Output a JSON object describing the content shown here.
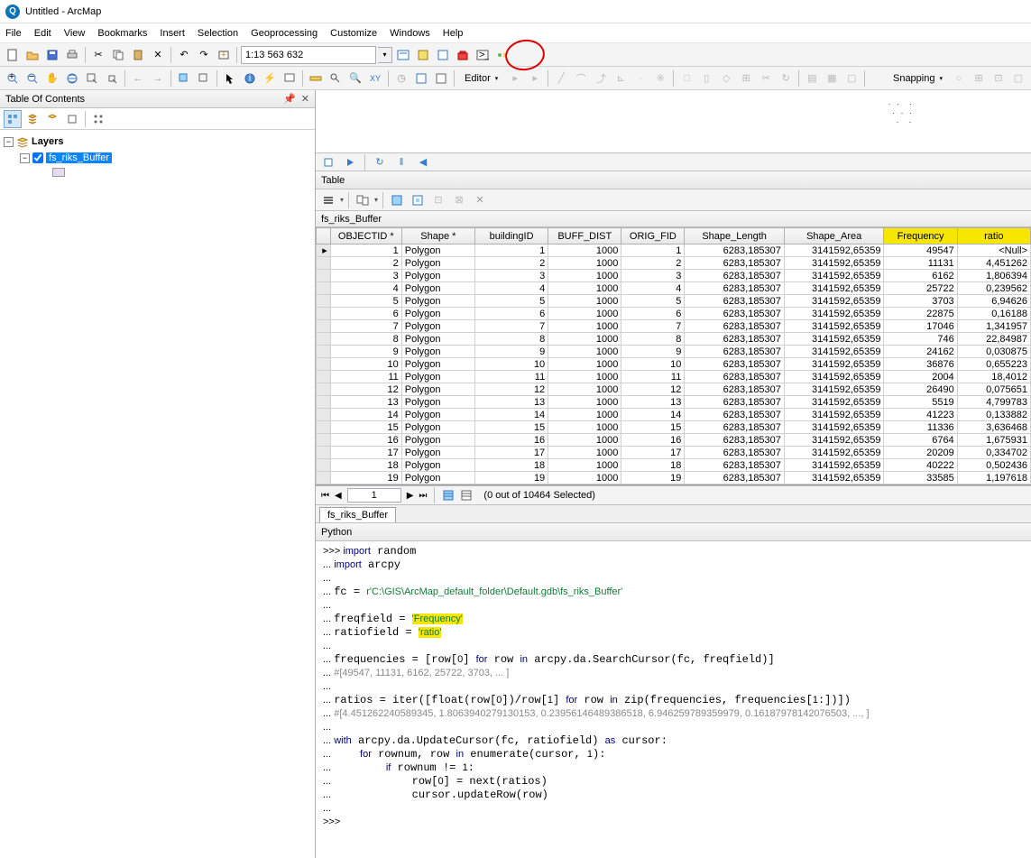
{
  "window": {
    "title": "Untitled - ArcMap"
  },
  "menu": [
    "File",
    "Edit",
    "View",
    "Bookmarks",
    "Insert",
    "Selection",
    "Geoprocessing",
    "Customize",
    "Windows",
    "Help"
  ],
  "scale": "1:13 563 632",
  "editor_label": "Editor",
  "snapping_label": "Snapping",
  "toc": {
    "title": "Table Of Contents",
    "root": "Layers",
    "layer": "fs_riks_Buffer"
  },
  "table": {
    "title": "Table",
    "name": "fs_riks_Buffer",
    "columns": [
      "OBJECTID *",
      "Shape *",
      "buildingID",
      "BUFF_DIST",
      "ORIG_FID",
      "Shape_Length",
      "Shape_Area",
      "Frequency",
      "ratio"
    ],
    "highlight_cols": [
      7,
      8
    ],
    "rows": [
      [
        1,
        "Polygon",
        1,
        1000,
        1,
        "6283,185307",
        "3141592,65359",
        49547,
        "<Null>"
      ],
      [
        2,
        "Polygon",
        2,
        1000,
        2,
        "6283,185307",
        "3141592,65359",
        11131,
        "4,451262"
      ],
      [
        3,
        "Polygon",
        3,
        1000,
        3,
        "6283,185307",
        "3141592,65359",
        6162,
        "1,806394"
      ],
      [
        4,
        "Polygon",
        4,
        1000,
        4,
        "6283,185307",
        "3141592,65359",
        25722,
        "0,239562"
      ],
      [
        5,
        "Polygon",
        5,
        1000,
        5,
        "6283,185307",
        "3141592,65359",
        3703,
        "6,94626"
      ],
      [
        6,
        "Polygon",
        6,
        1000,
        6,
        "6283,185307",
        "3141592,65359",
        22875,
        "0,16188"
      ],
      [
        7,
        "Polygon",
        7,
        1000,
        7,
        "6283,185307",
        "3141592,65359",
        17046,
        "1,341957"
      ],
      [
        8,
        "Polygon",
        8,
        1000,
        8,
        "6283,185307",
        "3141592,65359",
        746,
        "22,84987"
      ],
      [
        9,
        "Polygon",
        9,
        1000,
        9,
        "6283,185307",
        "3141592,65359",
        24162,
        "0,030875"
      ],
      [
        10,
        "Polygon",
        10,
        1000,
        10,
        "6283,185307",
        "3141592,65359",
        36876,
        "0,655223"
      ],
      [
        11,
        "Polygon",
        11,
        1000,
        11,
        "6283,185307",
        "3141592,65359",
        2004,
        "18,4012"
      ],
      [
        12,
        "Polygon",
        12,
        1000,
        12,
        "6283,185307",
        "3141592,65359",
        26490,
        "0,075651"
      ],
      [
        13,
        "Polygon",
        13,
        1000,
        13,
        "6283,185307",
        "3141592,65359",
        5519,
        "4,799783"
      ],
      [
        14,
        "Polygon",
        14,
        1000,
        14,
        "6283,185307",
        "3141592,65359",
        41223,
        "0,133882"
      ],
      [
        15,
        "Polygon",
        15,
        1000,
        15,
        "6283,185307",
        "3141592,65359",
        11336,
        "3,636468"
      ],
      [
        16,
        "Polygon",
        16,
        1000,
        16,
        "6283,185307",
        "3141592,65359",
        6764,
        "1,675931"
      ],
      [
        17,
        "Polygon",
        17,
        1000,
        17,
        "6283,185307",
        "3141592,65359",
        20209,
        "0,334702"
      ],
      [
        18,
        "Polygon",
        18,
        1000,
        18,
        "6283,185307",
        "3141592,65359",
        40222,
        "0,502436"
      ],
      [
        19,
        "Polygon",
        19,
        1000,
        19,
        "6283,185307",
        "3141592,65359",
        33585,
        "1,197618"
      ]
    ],
    "nav_current": "1",
    "nav_status": "(0 out of 10464 Selected)",
    "tab": "fs_riks_Buffer"
  },
  "python": {
    "title": "Python",
    "fc_path": "r'C:\\GIS\\ArcMap_default_folder\\Default.gdb\\fs_riks_Buffer'",
    "freq_str": "'Frequency'",
    "ratio_str": "'ratio'",
    "sample_freqs": "#[49547, 11131, 6162, 25722, 3703, ... ]",
    "sample_ratios": "#[4.451262240589345, 1.8063940279130153, 0.23956146489386518, 6.946259789359979, 0.16187978142076503, ..., ]"
  }
}
